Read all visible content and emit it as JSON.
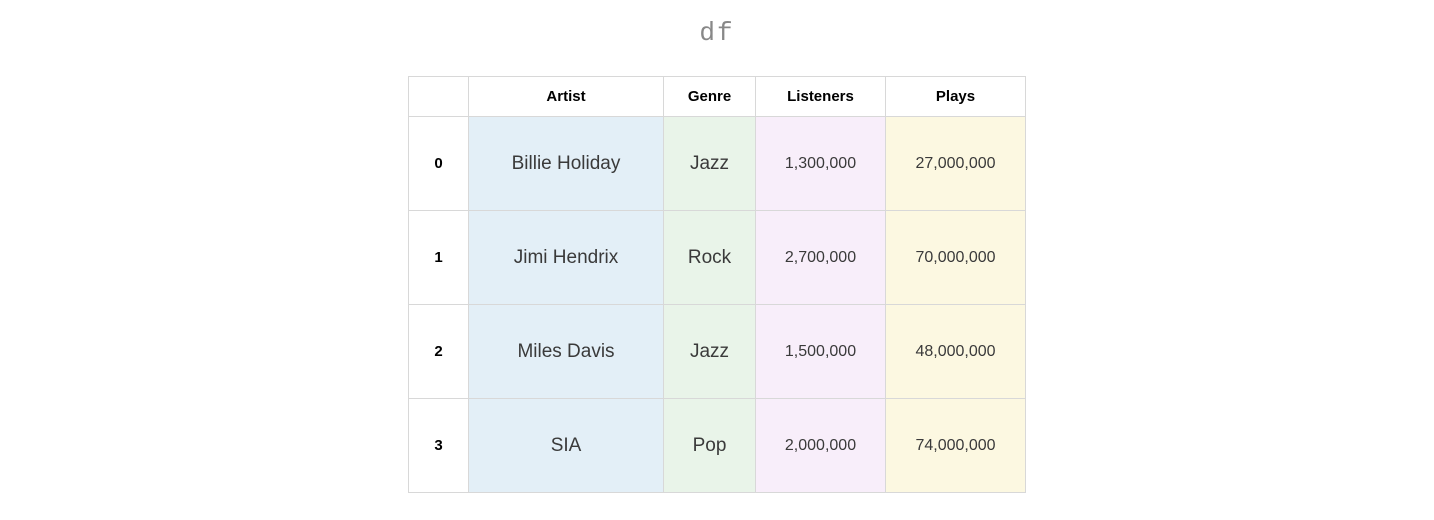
{
  "title": "df",
  "columns": {
    "artist": "Artist",
    "genre": "Genre",
    "listeners": "Listeners",
    "plays": "Plays"
  },
  "rows": [
    {
      "index": "0",
      "artist": "Billie Holiday",
      "genre": "Jazz",
      "listeners": "1,300,000",
      "plays": "27,000,000"
    },
    {
      "index": "1",
      "artist": "Jimi Hendrix",
      "genre": "Rock",
      "listeners": "2,700,000",
      "plays": "70,000,000"
    },
    {
      "index": "2",
      "artist": "Miles Davis",
      "genre": "Jazz",
      "listeners": "1,500,000",
      "plays": "48,000,000"
    },
    {
      "index": "3",
      "artist": "SIA",
      "genre": "Pop",
      "listeners": "2,000,000",
      "plays": "74,000,000"
    }
  ],
  "chart_data": {
    "type": "table",
    "title": "df",
    "columns": [
      "Artist",
      "Genre",
      "Listeners",
      "Plays"
    ],
    "index": [
      0,
      1,
      2,
      3
    ],
    "data": [
      [
        "Billie Holiday",
        "Jazz",
        1300000,
        27000000
      ],
      [
        "Jimi Hendrix",
        "Rock",
        2700000,
        70000000
      ],
      [
        "Miles Davis",
        "Jazz",
        1500000,
        48000000
      ],
      [
        "SIA",
        "Pop",
        2000000,
        74000000
      ]
    ]
  }
}
